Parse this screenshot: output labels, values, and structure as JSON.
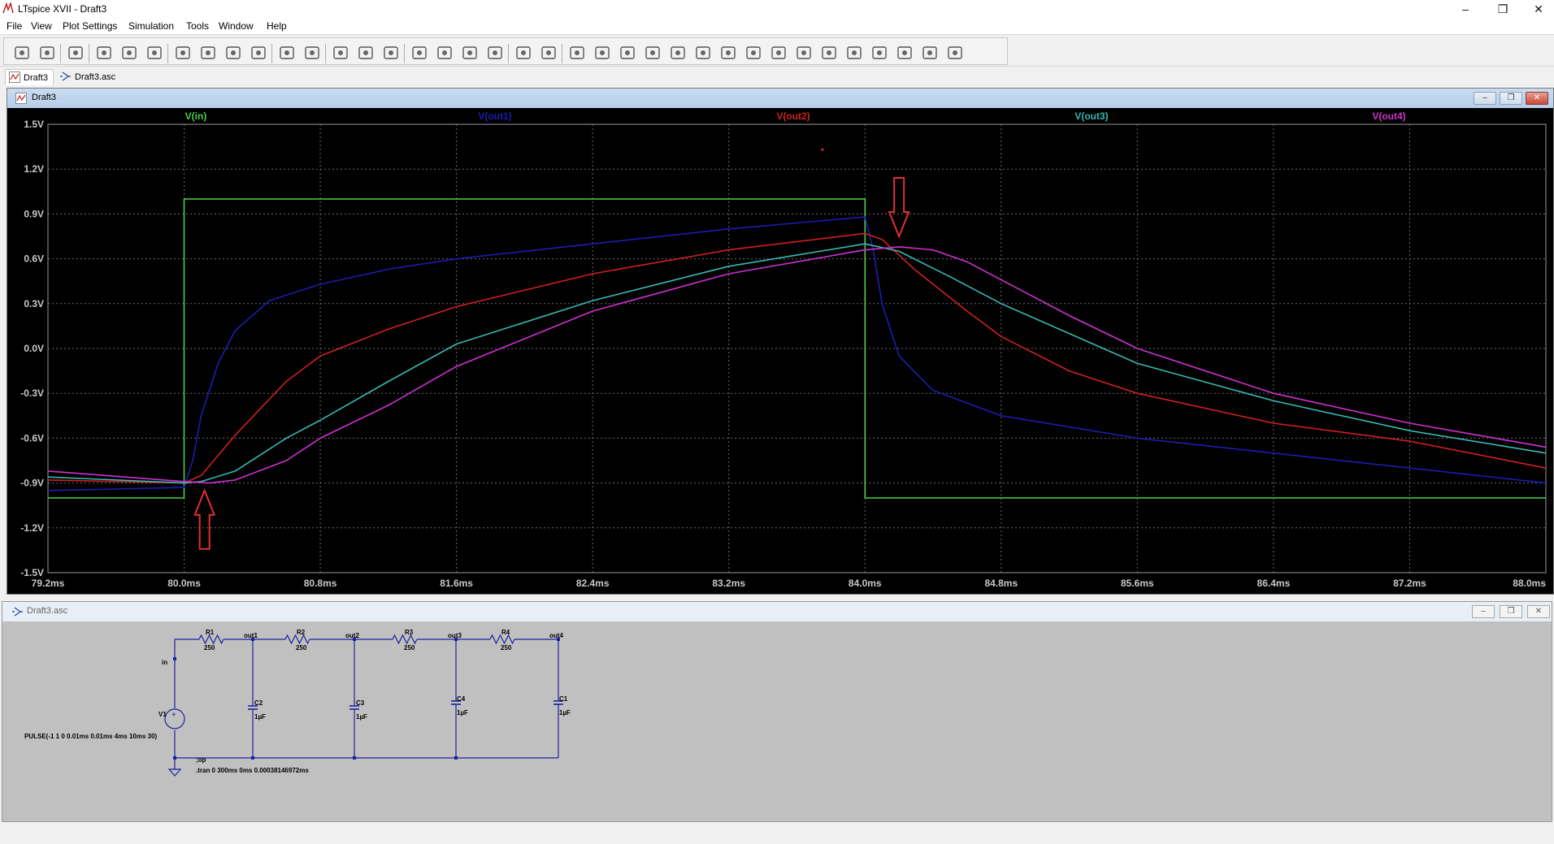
{
  "window": {
    "title": "LTspice XVII - Draft3",
    "minimize": "–",
    "restore": "❐",
    "close": "✕"
  },
  "menu": [
    "File",
    "View",
    "Plot Settings",
    "Simulation",
    "Tools",
    "Window",
    "Help"
  ],
  "toolbar": {
    "icons": [
      "run-icon",
      "open-icon",
      "save-icon",
      "control-panel-icon",
      "halt-icon",
      "pan-hand-icon",
      "zoom-in-icon",
      "zoom-area-icon",
      "zoom-out-icon",
      "zoom-cancel-icon",
      "autorange-icon",
      "fit-icon",
      "tile-horizontal-icon",
      "tile-vertical-icon",
      "cascade-icon",
      "cut-icon",
      "copy-icon",
      "paste-icon",
      "find-icon",
      "print-icon",
      "print-setup-icon",
      "wire-icon",
      "ground-icon",
      "label-net-icon",
      "resistor-icon",
      "capacitor-icon",
      "inductor-icon",
      "diode-icon",
      "component-icon",
      "move-hand-icon",
      "drag-hand-icon",
      "undo-icon",
      "redo-icon",
      "rotate-icon",
      "mirror-icon",
      "text-icon",
      "spice-directive-icon"
    ]
  },
  "tabs": [
    {
      "label": "Draft3",
      "icon": "waveform-icon"
    },
    {
      "label": "Draft3.asc",
      "icon": "schematic-icon"
    }
  ],
  "plot_window": {
    "title": "Draft3",
    "buttons": {
      "minimize": "–",
      "restore": "❐",
      "close": "✕"
    }
  },
  "chart_data": {
    "type": "line",
    "xlabel": "",
    "ylabel": "",
    "xlim": [
      79.2,
      88.0
    ],
    "ylim": [
      -1.5,
      1.5
    ],
    "grid": true,
    "legend_placement": "top",
    "background": "#000000",
    "grid_color": "#6b6b6b",
    "axis_label_color": "#c8c8c8",
    "xticks": [
      79.2,
      80.0,
      80.8,
      81.6,
      82.4,
      83.2,
      84.0,
      84.8,
      85.6,
      86.4,
      87.2,
      88.0
    ],
    "xtick_labels": [
      "79.2ms",
      "80.0ms",
      "80.8ms",
      "81.6ms",
      "82.4ms",
      "83.2ms",
      "84.0ms",
      "84.8ms",
      "85.6ms",
      "86.4ms",
      "87.2ms",
      "88.0ms"
    ],
    "yticks": [
      1.5,
      1.2,
      0.9,
      0.6,
      0.3,
      0.0,
      -0.3,
      -0.6,
      -0.9,
      -1.2,
      -1.5
    ],
    "ytick_labels": [
      "1.5V",
      "1.2V",
      "0.9V",
      "0.6V",
      "0.3V",
      "0.0V",
      "-0.3V",
      "-0.6V",
      "-0.9V",
      "-1.2V",
      "-1.5V"
    ],
    "series": [
      {
        "name": "V(in)",
        "color": "#4ad04a",
        "x": [
          79.2,
          80.0,
          80.0,
          84.0,
          84.0,
          88.0
        ],
        "y": [
          -1.0,
          -1.0,
          1.0,
          1.0,
          -1.0,
          -1.0
        ]
      },
      {
        "name": "V(out1)",
        "color": "#1c1cb0",
        "x": [
          79.2,
          80.0,
          80.05,
          80.1,
          80.2,
          80.3,
          80.5,
          80.8,
          81.2,
          81.6,
          82.4,
          83.2,
          84.0,
          84.05,
          84.1,
          84.2,
          84.4,
          84.8,
          85.6,
          86.4,
          87.2,
          88.0
        ],
        "y": [
          -0.95,
          -0.93,
          -0.75,
          -0.45,
          -0.1,
          0.12,
          0.32,
          0.43,
          0.53,
          0.6,
          0.7,
          0.8,
          0.88,
          0.65,
          0.3,
          -0.05,
          -0.28,
          -0.45,
          -0.6,
          -0.7,
          -0.8,
          -0.9
        ]
      },
      {
        "name": "V(out2)",
        "color": "#d02020",
        "x": [
          79.2,
          80.0,
          80.1,
          80.3,
          80.6,
          80.8,
          81.2,
          81.6,
          82.4,
          83.2,
          84.0,
          84.1,
          84.3,
          84.6,
          84.8,
          85.2,
          85.6,
          86.4,
          87.2,
          88.0
        ],
        "y": [
          -0.88,
          -0.9,
          -0.85,
          -0.58,
          -0.22,
          -0.05,
          0.13,
          0.28,
          0.5,
          0.66,
          0.77,
          0.73,
          0.52,
          0.25,
          0.08,
          -0.15,
          -0.3,
          -0.5,
          -0.62,
          -0.8
        ]
      },
      {
        "name": "V(out3)",
        "color": "#38b8b0",
        "x": [
          79.2,
          80.0,
          80.1,
          80.3,
          80.6,
          80.8,
          81.2,
          81.6,
          82.4,
          83.2,
          84.0,
          84.2,
          84.5,
          84.8,
          85.2,
          85.6,
          86.4,
          87.2,
          88.0
        ],
        "y": [
          -0.86,
          -0.9,
          -0.89,
          -0.82,
          -0.6,
          -0.48,
          -0.22,
          0.03,
          0.32,
          0.55,
          0.7,
          0.65,
          0.48,
          0.3,
          0.1,
          -0.1,
          -0.35,
          -0.55,
          -0.7
        ]
      },
      {
        "name": "V(out4)",
        "color": "#d030d0",
        "x": [
          79.2,
          80.0,
          80.15,
          80.3,
          80.6,
          80.8,
          81.2,
          81.6,
          82.4,
          83.2,
          84.0,
          84.2,
          84.4,
          84.6,
          84.8,
          85.2,
          85.6,
          86.4,
          87.2,
          88.0
        ],
        "y": [
          -0.82,
          -0.89,
          -0.9,
          -0.88,
          -0.75,
          -0.6,
          -0.38,
          -0.12,
          0.25,
          0.5,
          0.66,
          0.68,
          0.66,
          0.58,
          0.46,
          0.22,
          0.0,
          -0.3,
          -0.5,
          -0.66
        ]
      }
    ],
    "annotations": [
      {
        "type": "arrow",
        "direction": "down",
        "x": 84.2,
        "y": 0.75,
        "color": "#e03030"
      },
      {
        "type": "arrow",
        "direction": "up",
        "x": 80.12,
        "y": -0.95,
        "color": "#e03030"
      }
    ]
  },
  "schematic_window": {
    "title": "Draft3.asc",
    "buttons": {
      "minimize": "–",
      "restore": "❐",
      "close": "✕"
    },
    "nets": [
      "in",
      "out1",
      "out2",
      "out3",
      "out4"
    ],
    "resistors": [
      {
        "name": "R1",
        "value": "250"
      },
      {
        "name": "R2",
        "value": "250"
      },
      {
        "name": "R3",
        "value": "250"
      },
      {
        "name": "R4",
        "value": "250"
      }
    ],
    "capacitors": [
      {
        "name": "C2",
        "value": "1µF"
      },
      {
        "name": "C3",
        "value": "1µF"
      },
      {
        "name": "C4",
        "value": "1µF"
      },
      {
        "name": "C1",
        "value": "1µF"
      }
    ],
    "source": {
      "name": "V1",
      "value": "PULSE(-1 1 0 0.01ms 0.01ms 4ms 10ms 30)"
    },
    "directives": [
      ";op",
      ".tran 0 300ms 0ms 0.00038146972ms"
    ],
    "wire_color": "#2020a0"
  }
}
